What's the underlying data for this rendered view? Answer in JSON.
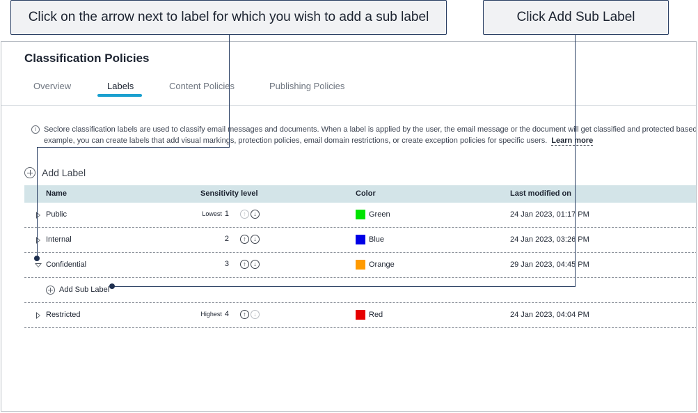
{
  "callouts": {
    "left": "Click on the arrow next to label for which you wish to add a sub label",
    "right": "Click Add Sub Label"
  },
  "page": {
    "title": "Classification Policies"
  },
  "tabs": [
    {
      "label": "Overview"
    },
    {
      "label": "Labels",
      "active": true
    },
    {
      "label": "Content Policies"
    },
    {
      "label": "Publishing Policies"
    }
  ],
  "info": {
    "icon": "info-icon",
    "line1": "Seclore classification labels are used to classify email messages and documents. When a label is applied by the user, the email message or the document will get classified and protected based o",
    "line2": "example, you can create labels that add visual markings, protection policies, email domain restrictions, or create exception policies for specific users.",
    "learn_more": "Learn more"
  },
  "add_label": "Add Label",
  "table": {
    "headers": {
      "name": "Name",
      "sensitivity": "Sensitivity level",
      "color": "Color",
      "modified": "Last modified on"
    },
    "rows": [
      {
        "name": "Public",
        "tag": "Lowest",
        "level": "1",
        "color_name": "Green",
        "color": "#00e400",
        "modified": "24 Jan 2023, 01:17 PM"
      },
      {
        "name": "Internal",
        "tag": "",
        "level": "2",
        "color_name": "Blue",
        "color": "#0000e6",
        "modified": "24 Jan 2023, 03:26 PM"
      },
      {
        "name": "Confidential",
        "tag": "",
        "level": "3",
        "color_name": "Orange",
        "color": "#ff9a00",
        "modified": "29 Jan 2023, 04:45 PM"
      },
      {
        "name": "Restricted",
        "tag": "Highest",
        "level": "4",
        "color_name": "Red",
        "color": "#e60000",
        "modified": "24 Jan 2023, 04:04 PM"
      }
    ],
    "add_sub_label": "Add Sub Label"
  }
}
